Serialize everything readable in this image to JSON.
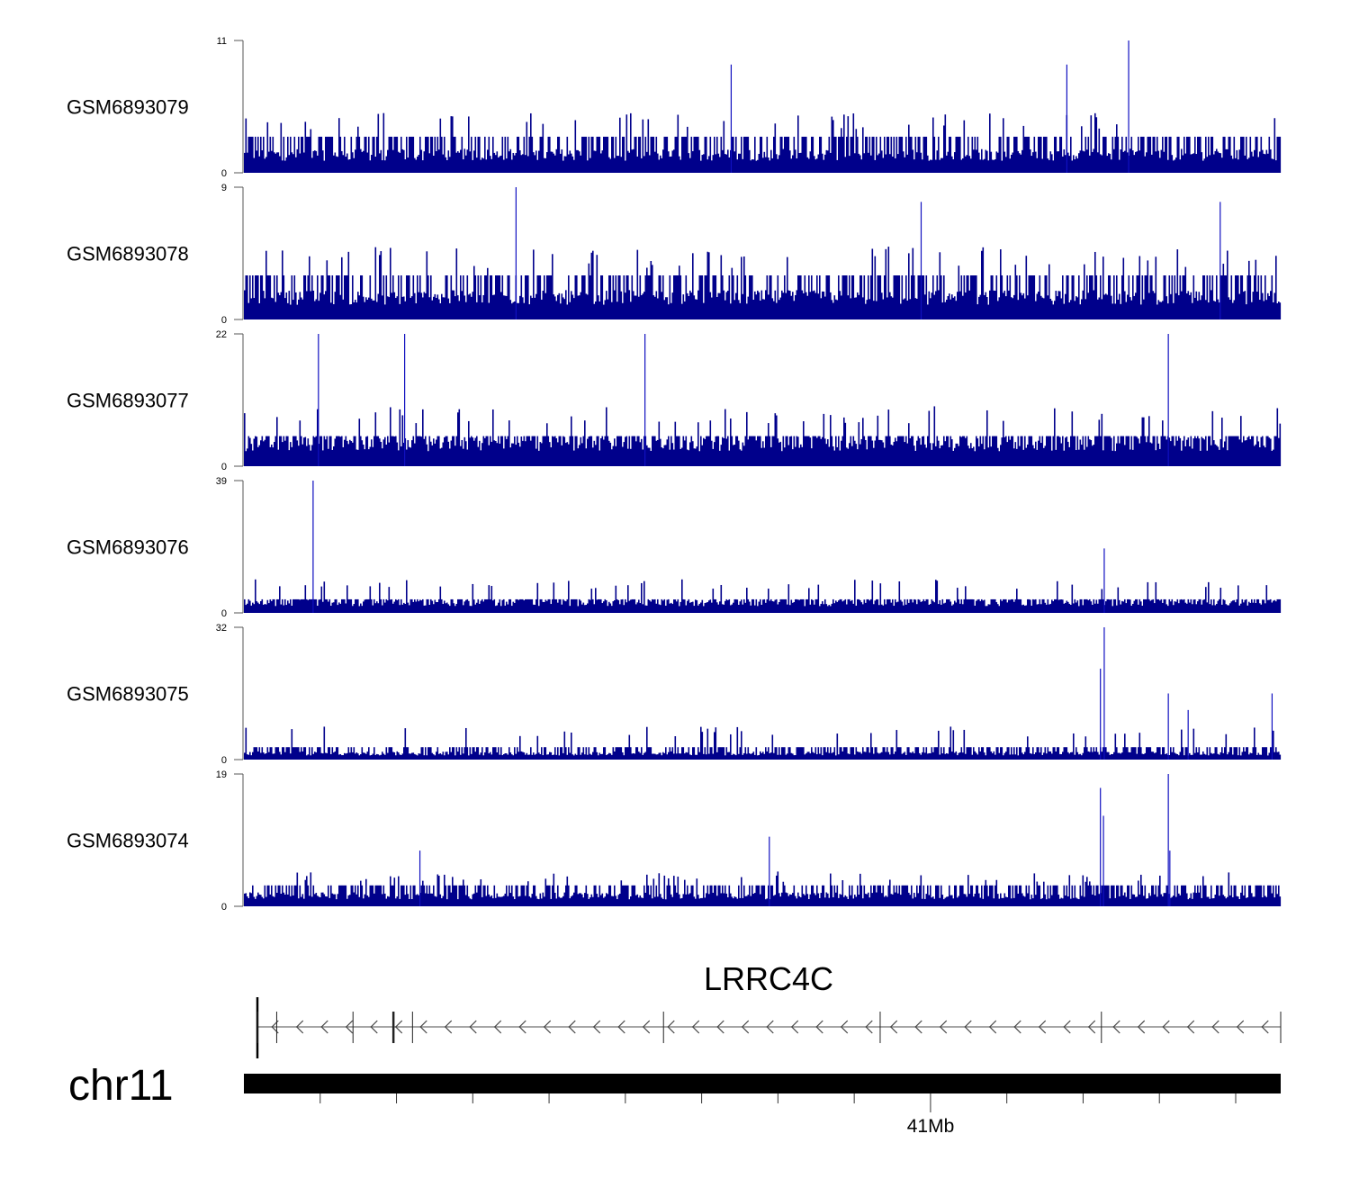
{
  "chart_data": {
    "type": "bar",
    "title": "",
    "chromosome": "chr11",
    "xlim_mb": [
      40.1,
      41.459
    ],
    "axis_tick_interval_mb": 0.2,
    "axis_labels": [
      {
        "value_mb": 41.0,
        "text": "41Mb"
      }
    ],
    "gene": {
      "name": "LRRC4C",
      "strand": "-",
      "start_mb": 40.118,
      "end_mb": 41.459,
      "exons_mb": [
        40.118,
        40.143,
        40.243,
        40.296,
        40.321,
        40.65,
        40.934,
        41.224,
        41.459
      ]
    },
    "tracks": [
      {
        "name": "GSM6893079",
        "ylim": [
          0,
          11
        ],
        "ymax_label": "11",
        "ymin_label": "0",
        "baseline": 2,
        "typical": 3,
        "spike": 5,
        "peaks": [
          {
            "x_mb": 41.259,
            "y": 11
          },
          {
            "x_mb": 40.738,
            "y": 9
          },
          {
            "x_mb": 41.178,
            "y": 9
          }
        ]
      },
      {
        "name": "GSM6893078",
        "ylim": [
          0,
          9
        ],
        "ymax_label": "9",
        "ymin_label": "0",
        "baseline": 2,
        "typical": 3,
        "spike": 5,
        "peaks": [
          {
            "x_mb": 40.456,
            "y": 9
          },
          {
            "x_mb": 40.987,
            "y": 8
          },
          {
            "x_mb": 41.379,
            "y": 8
          }
        ]
      },
      {
        "name": "GSM6893077",
        "ylim": [
          0,
          22
        ],
        "ymax_label": "22",
        "ymin_label": "0",
        "baseline": 5,
        "typical": 5,
        "spike": 10,
        "peaks": [
          {
            "x_mb": 40.197,
            "y": 22
          },
          {
            "x_mb": 40.31,
            "y": 22
          },
          {
            "x_mb": 40.625,
            "y": 22
          },
          {
            "x_mb": 41.311,
            "y": 22
          }
        ]
      },
      {
        "name": "GSM6893076",
        "ylim": [
          0,
          39
        ],
        "ymax_label": "39",
        "ymin_label": "0",
        "baseline": 4,
        "typical": 4,
        "spike": 10,
        "peaks": [
          {
            "x_mb": 40.19,
            "y": 39
          },
          {
            "x_mb": 41.227,
            "y": 19
          }
        ]
      },
      {
        "name": "GSM6893075",
        "ylim": [
          0,
          32
        ],
        "ymax_label": "32",
        "ymin_label": "0",
        "baseline": 2,
        "typical": 3,
        "spike": 8,
        "peaks": [
          {
            "x_mb": 41.227,
            "y": 32
          },
          {
            "x_mb": 41.222,
            "y": 22
          },
          {
            "x_mb": 41.311,
            "y": 16
          },
          {
            "x_mb": 41.337,
            "y": 12
          },
          {
            "x_mb": 41.447,
            "y": 16
          }
        ]
      },
      {
        "name": "GSM6893074",
        "ylim": [
          0,
          19
        ],
        "ymax_label": "19",
        "ymin_label": "0",
        "baseline": 2,
        "typical": 3,
        "spike": 5,
        "peaks": [
          {
            "x_mb": 41.222,
            "y": 17
          },
          {
            "x_mb": 41.226,
            "y": 13
          },
          {
            "x_mb": 41.311,
            "y": 19
          },
          {
            "x_mb": 41.313,
            "y": 8
          },
          {
            "x_mb": 40.788,
            "y": 10
          },
          {
            "x_mb": 40.33,
            "y": 8
          }
        ]
      }
    ]
  },
  "colors": {
    "signal": "#00008B",
    "axis": "#555555",
    "gene": "#000000"
  }
}
